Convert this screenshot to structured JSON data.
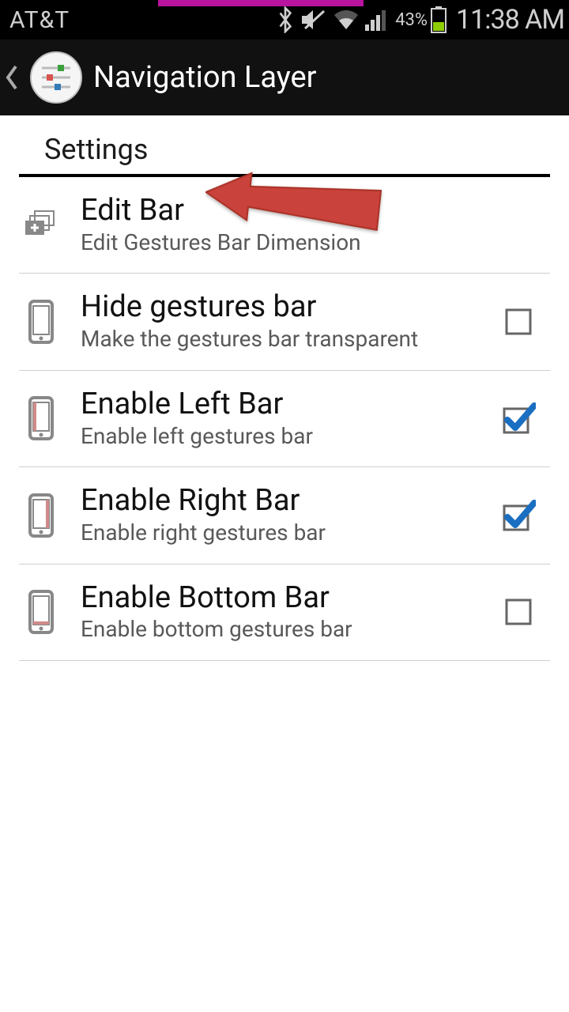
{
  "status": {
    "carrier": "AT&T",
    "battery_percent": "43%",
    "time": "11:38 AM"
  },
  "header": {
    "title": "Navigation Layer"
  },
  "section_header": "Settings",
  "rows": [
    {
      "title": "Edit Bar",
      "sub": "Edit Gestures Bar Dimension"
    },
    {
      "title": "Hide gestures bar",
      "sub": "Make the gestures bar transparent",
      "checked": false
    },
    {
      "title": "Enable Left Bar",
      "sub": "Enable left gestures bar",
      "checked": true
    },
    {
      "title": "Enable Right Bar",
      "sub": "Enable right gestures bar",
      "checked": true
    },
    {
      "title": "Enable Bottom Bar",
      "sub": "Enable bottom gestures bar",
      "checked": false
    }
  ]
}
